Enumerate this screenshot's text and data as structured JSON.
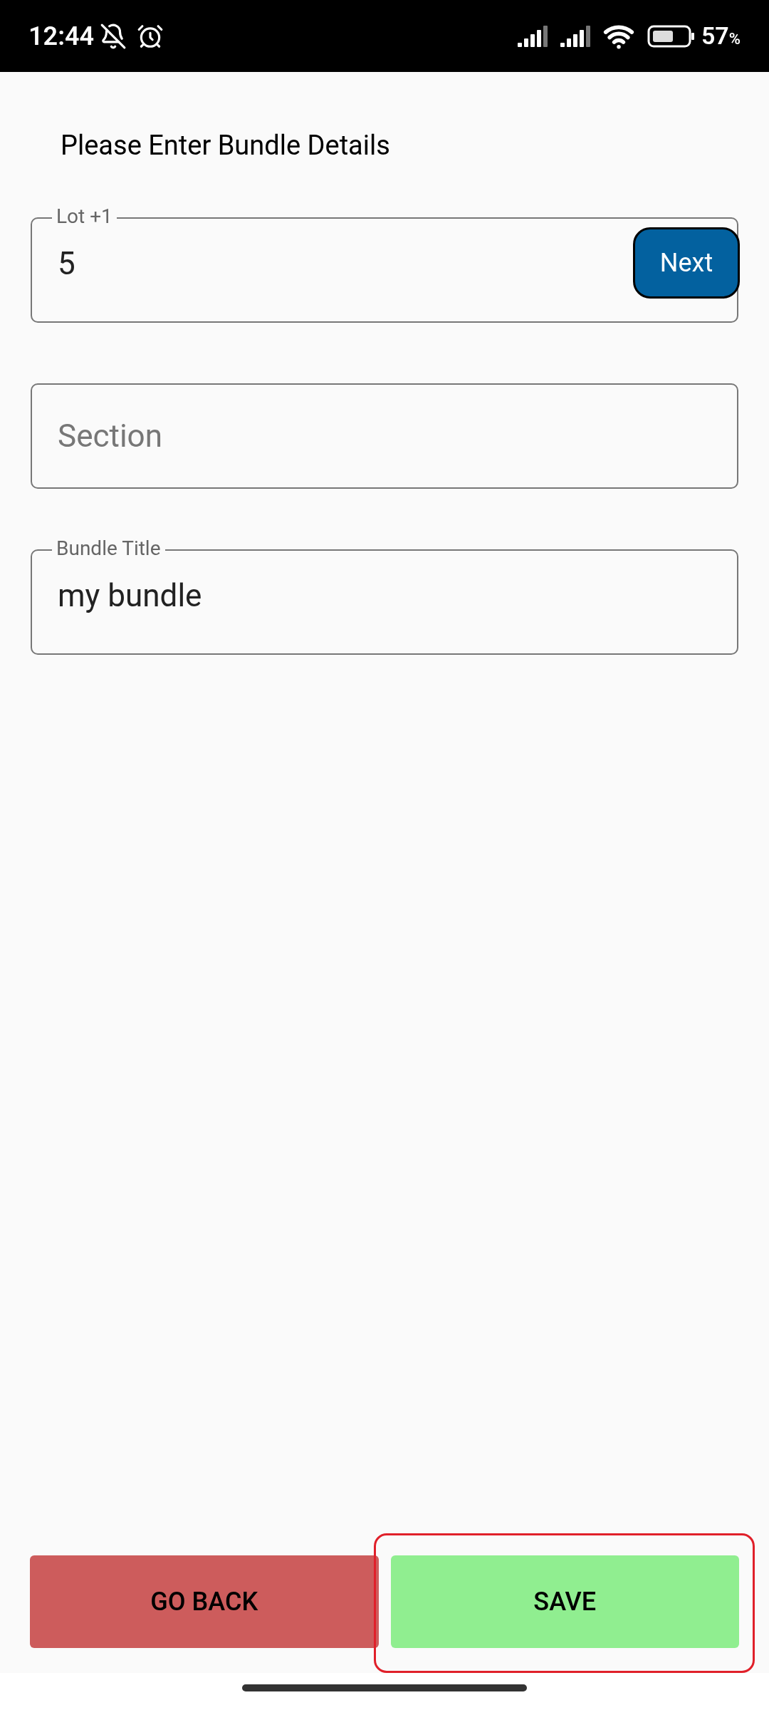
{
  "status_bar": {
    "time": "12:44",
    "battery": "57",
    "battery_unit": "%"
  },
  "heading": "Please Enter Bundle Details",
  "fields": [
    {
      "label": "Lot +1",
      "value": "5",
      "action": "Next"
    },
    {
      "placeholder": "Section"
    },
    {
      "label": "Bundle Title",
      "value": "my bundle"
    }
  ],
  "buttons": [
    {
      "label": "GO BACK",
      "kind": "back",
      "highlighted": false
    },
    {
      "label": "SAVE",
      "kind": "save",
      "highlighted": true
    }
  ]
}
